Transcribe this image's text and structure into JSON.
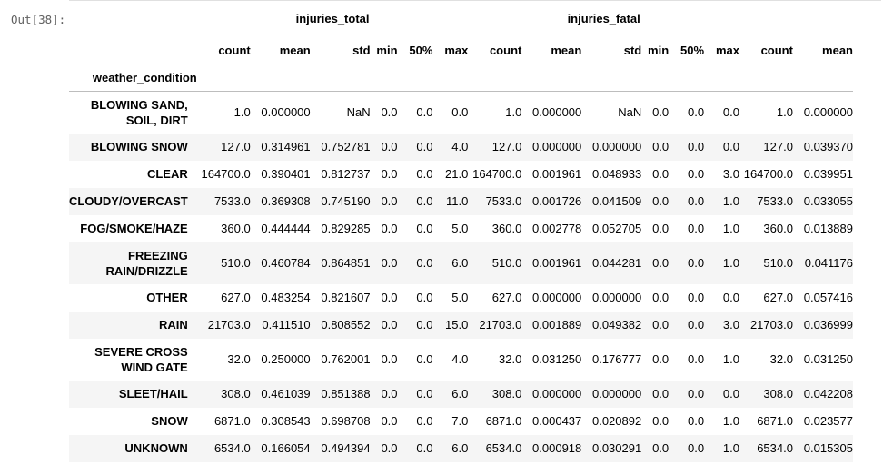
{
  "prompt_label": "Out[38]:",
  "index_name": "weather_condition",
  "groups": [
    {
      "label": "injuries_total"
    },
    {
      "label": "injuries_fatal"
    }
  ],
  "columns": [
    "count",
    "mean",
    "std",
    "min",
    "50%",
    "max",
    "count",
    "mean",
    "std",
    "min",
    "50%",
    "max",
    "count",
    "mean"
  ],
  "rows": [
    {
      "name": "BLOWING SAND,\nSOIL, DIRT",
      "tall": true,
      "values": [
        "1.0",
        "0.000000",
        "NaN",
        "0.0",
        "0.0",
        "0.0",
        "1.0",
        "0.000000",
        "NaN",
        "0.0",
        "0.0",
        "0.0",
        "1.0",
        "0.000000"
      ]
    },
    {
      "name": "BLOWING SNOW",
      "tall": false,
      "values": [
        "127.0",
        "0.314961",
        "0.752781",
        "0.0",
        "0.0",
        "4.0",
        "127.0",
        "0.000000",
        "0.000000",
        "0.0",
        "0.0",
        "0.0",
        "127.0",
        "0.039370"
      ]
    },
    {
      "name": "CLEAR",
      "tall": false,
      "values": [
        "164700.0",
        "0.390401",
        "0.812737",
        "0.0",
        "0.0",
        "21.0",
        "164700.0",
        "0.001961",
        "0.048933",
        "0.0",
        "0.0",
        "3.0",
        "164700.0",
        "0.039951"
      ]
    },
    {
      "name": "CLOUDY/OVERCAST",
      "tall": false,
      "values": [
        "7533.0",
        "0.369308",
        "0.745190",
        "0.0",
        "0.0",
        "11.0",
        "7533.0",
        "0.001726",
        "0.041509",
        "0.0",
        "0.0",
        "1.0",
        "7533.0",
        "0.033055"
      ]
    },
    {
      "name": "FOG/SMOKE/HAZE",
      "tall": false,
      "values": [
        "360.0",
        "0.444444",
        "0.829285",
        "0.0",
        "0.0",
        "5.0",
        "360.0",
        "0.002778",
        "0.052705",
        "0.0",
        "0.0",
        "1.0",
        "360.0",
        "0.013889"
      ]
    },
    {
      "name": "FREEZING\nRAIN/DRIZZLE",
      "tall": true,
      "values": [
        "510.0",
        "0.460784",
        "0.864851",
        "0.0",
        "0.0",
        "6.0",
        "510.0",
        "0.001961",
        "0.044281",
        "0.0",
        "0.0",
        "1.0",
        "510.0",
        "0.041176"
      ]
    },
    {
      "name": "OTHER",
      "tall": false,
      "values": [
        "627.0",
        "0.483254",
        "0.821607",
        "0.0",
        "0.0",
        "5.0",
        "627.0",
        "0.000000",
        "0.000000",
        "0.0",
        "0.0",
        "0.0",
        "627.0",
        "0.057416"
      ]
    },
    {
      "name": "RAIN",
      "tall": false,
      "values": [
        "21703.0",
        "0.411510",
        "0.808552",
        "0.0",
        "0.0",
        "15.0",
        "21703.0",
        "0.001889",
        "0.049382",
        "0.0",
        "0.0",
        "3.0",
        "21703.0",
        "0.036999"
      ]
    },
    {
      "name": "SEVERE CROSS\nWIND GATE",
      "tall": true,
      "values": [
        "32.0",
        "0.250000",
        "0.762001",
        "0.0",
        "0.0",
        "4.0",
        "32.0",
        "0.031250",
        "0.176777",
        "0.0",
        "0.0",
        "1.0",
        "32.0",
        "0.031250"
      ]
    },
    {
      "name": "SLEET/HAIL",
      "tall": false,
      "values": [
        "308.0",
        "0.461039",
        "0.851388",
        "0.0",
        "0.0",
        "6.0",
        "308.0",
        "0.000000",
        "0.000000",
        "0.0",
        "0.0",
        "0.0",
        "308.0",
        "0.042208"
      ]
    },
    {
      "name": "SNOW",
      "tall": false,
      "values": [
        "6871.0",
        "0.308543",
        "0.698708",
        "0.0",
        "0.0",
        "7.0",
        "6871.0",
        "0.000437",
        "0.020892",
        "0.0",
        "0.0",
        "1.0",
        "6871.0",
        "0.023577"
      ]
    },
    {
      "name": "UNKNOWN",
      "tall": false,
      "values": [
        "6534.0",
        "0.166054",
        "0.494394",
        "0.0",
        "0.0",
        "6.0",
        "6534.0",
        "0.000918",
        "0.030291",
        "0.0",
        "0.0",
        "1.0",
        "6534.0",
        "0.015305"
      ]
    }
  ]
}
